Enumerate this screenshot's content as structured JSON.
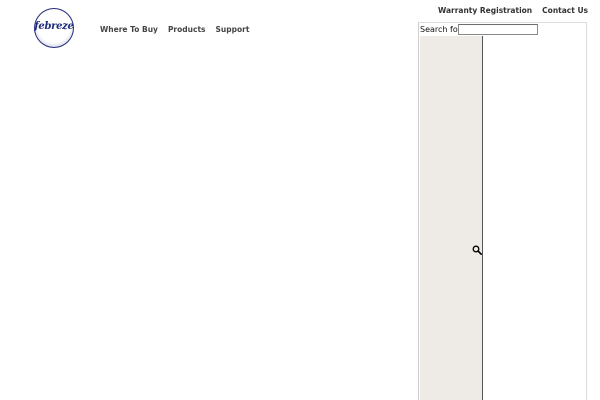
{
  "brand": {
    "logo_text": "febreze"
  },
  "primary_nav": [
    {
      "label": "Where To Buy"
    },
    {
      "label": "Products"
    },
    {
      "label": "Support"
    }
  ],
  "utility_nav": [
    {
      "label": "Warranty Registration"
    },
    {
      "label": "Contact Us"
    }
  ],
  "search": {
    "label": "Search for:",
    "value": "",
    "placeholder": "",
    "icon": "magnifier-icon"
  },
  "colors": {
    "brand_blue": "#1f2a7a",
    "panel_gray": "#eeebe6",
    "nav_text": "#444444"
  }
}
